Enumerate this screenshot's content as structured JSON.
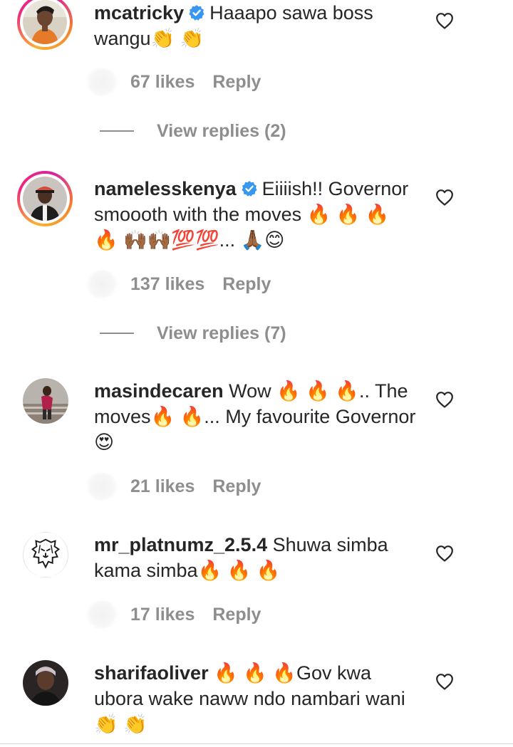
{
  "comments": [
    {
      "username": "mcatricky",
      "verified": true,
      "text": "Haaapo sawa boss wangu👏 👏",
      "likes": "67 likes",
      "reply": "Reply",
      "view_replies": "View replies (2)",
      "avatar": "avatar-photo-man-orange-shirt"
    },
    {
      "username": "namelesskenya",
      "verified": true,
      "text": "Eiiiish!! Governor smoooth with the moves 🔥 🔥 🔥 🔥 🙌🏾🙌🏾💯💯... 🙏🏾😊",
      "likes": "137 likes",
      "reply": "Reply",
      "view_replies": "View replies (7)",
      "avatar": "avatar-photo-man-cap"
    },
    {
      "username": "masindecaren",
      "verified": false,
      "text": "Wow 🔥 🔥 🔥.. The moves🔥 🔥... My favourite Governor 😍",
      "likes": "21 likes",
      "reply": "Reply",
      "avatar": "avatar-photo-woman-stairs"
    },
    {
      "username": "mr_platnumz_2.5.4",
      "verified": false,
      "text": "Shuwa simba kama simba🔥 🔥 🔥",
      "likes": "17 likes",
      "reply": "Reply",
      "avatar": "lion-head-icon"
    },
    {
      "username": "sharifaoliver",
      "verified": false,
      "text": "🔥 🔥 🔥Gov kwa ubora wake naww ndo nambari wani👏 👏",
      "avatar": "avatar-photo-woman-dark"
    }
  ],
  "colors": {
    "text": "#262626",
    "secondary": "#8e8e8e",
    "verified": "#3897f0",
    "story_ring": "#ee2a7b"
  }
}
